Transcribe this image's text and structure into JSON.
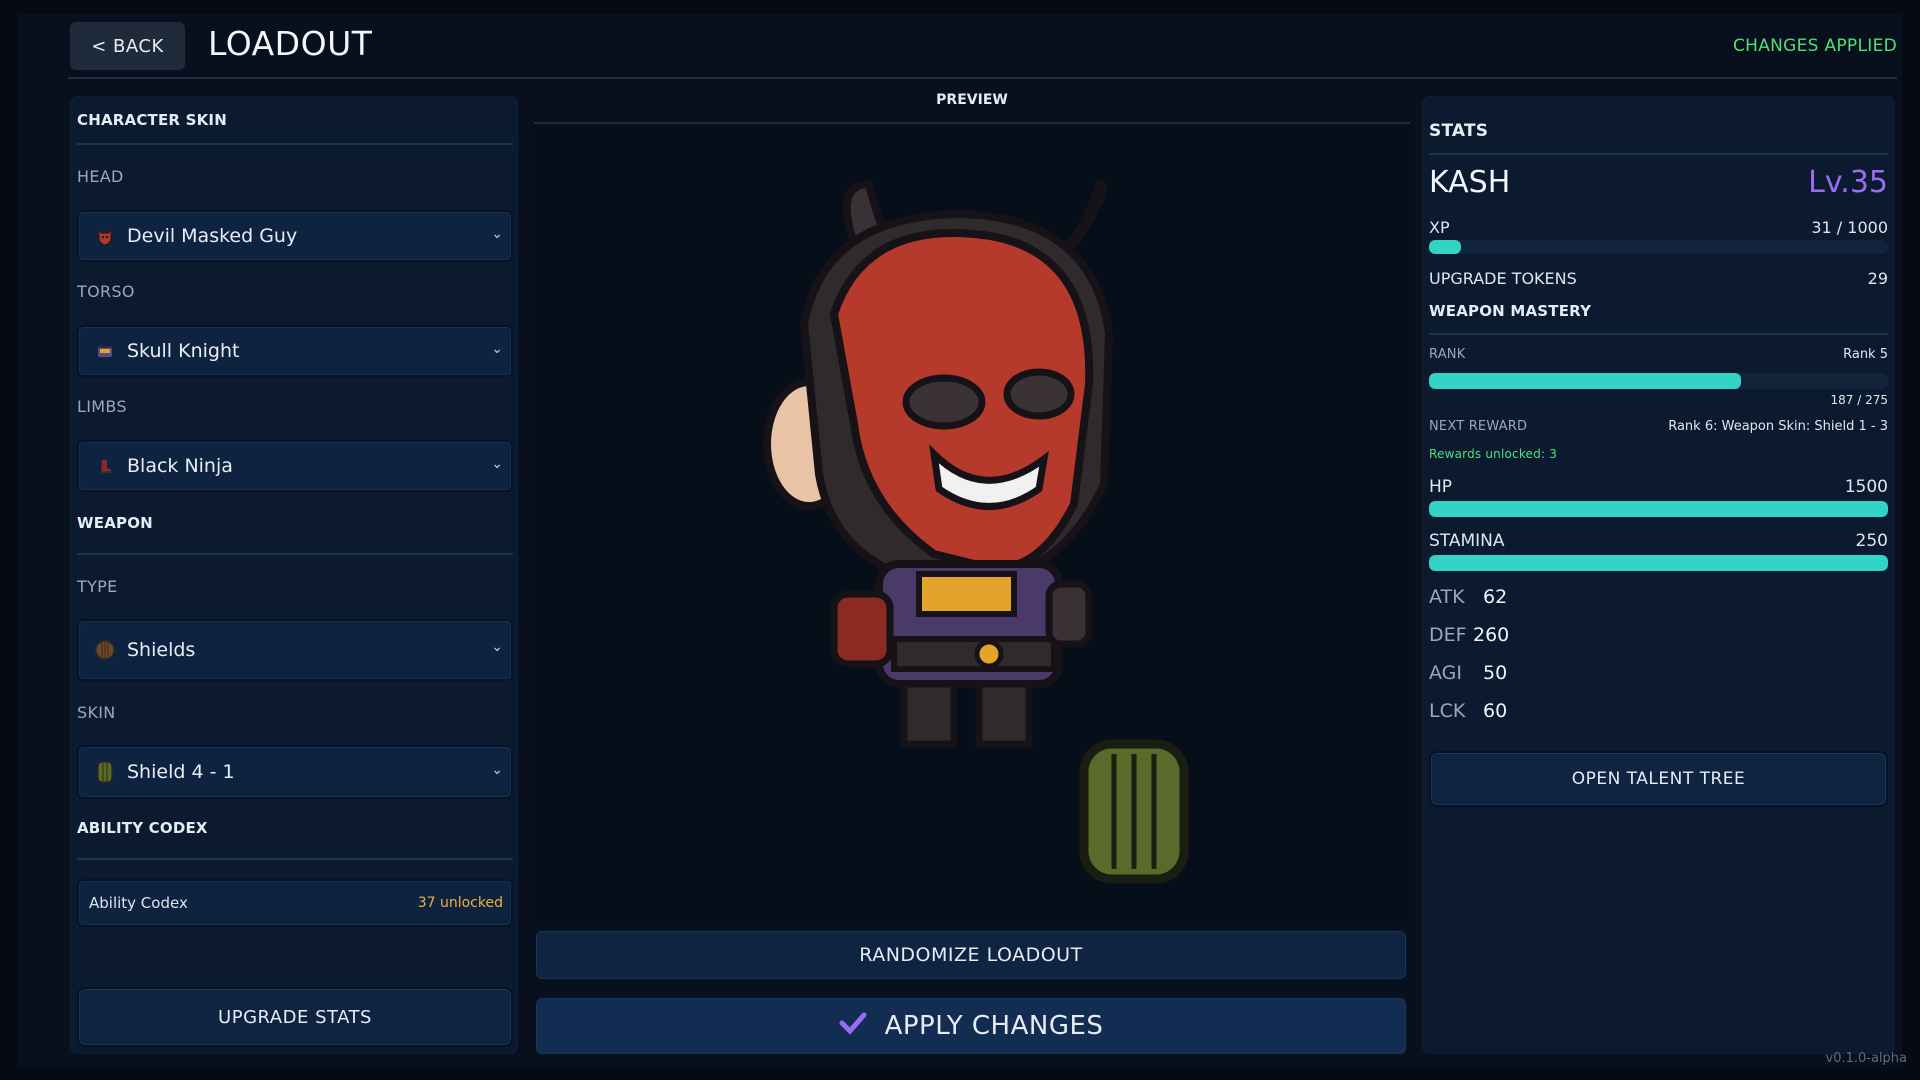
{
  "header": {
    "back_label": "< BACK",
    "title": "LOADOUT",
    "status": "CHANGES APPLIED"
  },
  "left": {
    "character_skin_title": "CHARACTER SKIN",
    "head_label": "HEAD",
    "head_value": "Devil Masked Guy",
    "torso_label": "TORSO",
    "torso_value": "Skull Knight",
    "limbs_label": "LIMBS",
    "limbs_value": "Black Ninja",
    "weapon_title": "WEAPON",
    "type_label": "TYPE",
    "type_value": "Shields",
    "skin_label": "SKIN",
    "skin_value": "Shield 4 - 1",
    "codex_title": "ABILITY CODEX",
    "codex_label": "Ability Codex",
    "codex_count": "37 unlocked",
    "upgrade_label": "UPGRADE STATS"
  },
  "preview": {
    "title": "PREVIEW",
    "randomize_label": "RANDOMIZE LOADOUT",
    "apply_label": "APPLY CHANGES"
  },
  "stats": {
    "title": "STATS",
    "name": "KASH",
    "level": "Lv.35",
    "xp_label": "XP",
    "xp_value": "31 / 1000",
    "xp_fraction": 0.031,
    "tokens_label": "UPGRADE TOKENS",
    "tokens_value": "29",
    "mastery_title": "WEAPON MASTERY",
    "rank_label": "RANK",
    "rank_value": "Rank 5",
    "rank_progress": "187 / 275",
    "rank_fraction": 0.68,
    "next_reward_label": "NEXT REWARD",
    "next_reward_value": "Rank 6: Weapon Skin: Shield 1 - 3",
    "rewards_unlocked": "Rewards unlocked: 3",
    "hp_label": "HP",
    "hp_value": "1500",
    "hp_fraction": 1.0,
    "stamina_label": "STAMINA",
    "stamina_value": "250",
    "stamina_fraction": 1.0,
    "atk_label": "ATK",
    "atk_value": "62",
    "def_label": "DEF",
    "def_value": "260",
    "agi_label": "AGI",
    "agi_value": "50",
    "lck_label": "LCK",
    "lck_value": "60",
    "talent_label": "OPEN TALENT TREE"
  },
  "footer": {
    "version": "v0.1.0-alpha"
  },
  "colors": {
    "accent_teal": "#33d3c5",
    "level_purple": "#9a6cf2",
    "status_green": "#4ee07a",
    "codex_orange": "#f0b23a"
  },
  "icons": {
    "head": "devil-head-icon",
    "torso": "skull-knight-icon",
    "limbs": "ninja-boot-icon",
    "type": "shield-round-icon",
    "skin": "shield-plank-icon",
    "apply": "check-icon"
  }
}
